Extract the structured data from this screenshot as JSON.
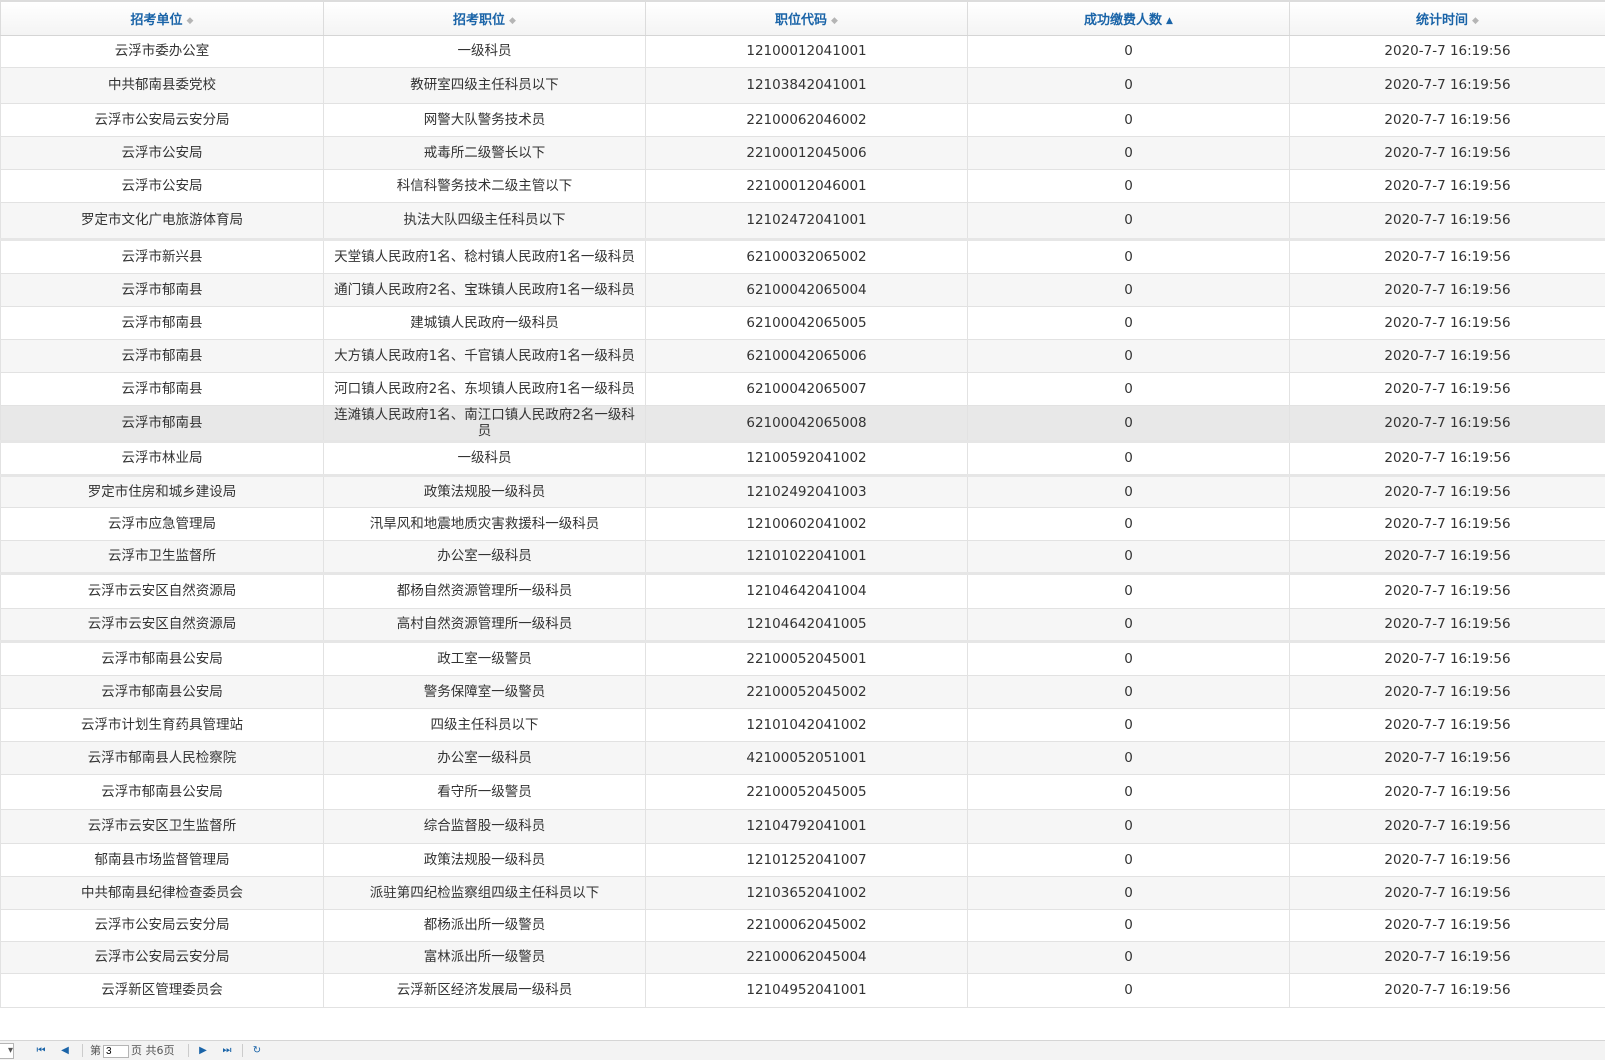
{
  "columns": [
    {
      "label": "招考单位",
      "sort": "none"
    },
    {
      "label": "招考职位",
      "sort": "none"
    },
    {
      "label": "职位代码",
      "sort": "none"
    },
    {
      "label": "成功缴费人数",
      "sort": "asc"
    },
    {
      "label": "统计时间",
      "sort": "none"
    }
  ],
  "rows": [
    [
      "云浮市委办公室",
      "一级科员",
      "12100012041001",
      "0",
      "2020-7-7 16:19:56"
    ],
    [
      "中共郁南县委党校",
      "教研室四级主任科员以下",
      "12103842041001",
      "0",
      "2020-7-7 16:19:56"
    ],
    [
      "云浮市公安局云安分局",
      "网警大队警务技术员",
      "22100062046002",
      "0",
      "2020-7-7 16:19:56"
    ],
    [
      "云浮市公安局",
      "戒毒所二级警长以下",
      "22100012045006",
      "0",
      "2020-7-7 16:19:56"
    ],
    [
      "云浮市公安局",
      "科信科警务技术二级主管以下",
      "22100012046001",
      "0",
      "2020-7-7 16:19:56"
    ],
    [
      "罗定市文化广电旅游体育局",
      "执法大队四级主任科员以下",
      "12102472041001",
      "0",
      "2020-7-7 16:19:56"
    ],
    [
      "云浮市新兴县",
      "天堂镇人民政府1名、稔村镇人民政府1名一级科员",
      "62100032065002",
      "0",
      "2020-7-7 16:19:56"
    ],
    [
      "云浮市郁南县",
      "通门镇人民政府2名、宝珠镇人民政府1名一级科员",
      "62100042065004",
      "0",
      "2020-7-7 16:19:56"
    ],
    [
      "云浮市郁南县",
      "建城镇人民政府一级科员",
      "62100042065005",
      "0",
      "2020-7-7 16:19:56"
    ],
    [
      "云浮市郁南县",
      "大方镇人民政府1名、千官镇人民政府1名一级科员",
      "62100042065006",
      "0",
      "2020-7-7 16:19:56"
    ],
    [
      "云浮市郁南县",
      "河口镇人民政府2名、东坝镇人民政府1名一级科员",
      "62100042065007",
      "0",
      "2020-7-7 16:19:56"
    ],
    [
      "云浮市郁南县",
      "连滩镇人民政府1名、南江口镇人民政府2名一级科员",
      "62100042065008",
      "0",
      "2020-7-7 16:19:56"
    ],
    [
      "云浮市林业局",
      "一级科员",
      "12100592041002",
      "0",
      "2020-7-7 16:19:56"
    ],
    [
      "罗定市住房和城乡建设局",
      "政策法规股一级科员",
      "12102492041003",
      "0",
      "2020-7-7 16:19:56"
    ],
    [
      "云浮市应急管理局",
      "汛旱风和地震地质灾害救援科一级科员",
      "12100602041002",
      "0",
      "2020-7-7 16:19:56"
    ],
    [
      "云浮市卫生监督所",
      "办公室一级科员",
      "12101022041001",
      "0",
      "2020-7-7 16:19:56"
    ],
    [
      "云浮市云安区自然资源局",
      "都杨自然资源管理所一级科员",
      "12104642041004",
      "0",
      "2020-7-7 16:19:56"
    ],
    [
      "云浮市云安区自然资源局",
      "高村自然资源管理所一级科员",
      "12104642041005",
      "0",
      "2020-7-7 16:19:56"
    ],
    [
      "云浮市郁南县公安局",
      "政工室一级警员",
      "22100052045001",
      "0",
      "2020-7-7 16:19:56"
    ],
    [
      "云浮市郁南县公安局",
      "警务保障室一级警员",
      "22100052045002",
      "0",
      "2020-7-7 16:19:56"
    ],
    [
      "云浮市计划生育药具管理站",
      "四级主任科员以下",
      "12101042041002",
      "0",
      "2020-7-7 16:19:56"
    ],
    [
      "云浮市郁南县人民检察院",
      "办公室一级科员",
      "42100052051001",
      "0",
      "2020-7-7 16:19:56"
    ],
    [
      "云浮市郁南县公安局",
      "看守所一级警员",
      "22100052045005",
      "0",
      "2020-7-7 16:19:56"
    ],
    [
      "云浮市云安区卫生监督所",
      "综合监督股一级科员",
      "12104792041001",
      "0",
      "2020-7-7 16:19:56"
    ],
    [
      "郁南县市场监督管理局",
      "政策法规股一级科员",
      "12101252041007",
      "0",
      "2020-7-7 16:19:56"
    ],
    [
      "中共郁南县纪律检查委员会",
      "派驻第四纪检监察组四级主任科员以下",
      "12103652041002",
      "0",
      "2020-7-7 16:19:56"
    ],
    [
      "云浮市公安局云安分局",
      "都杨派出所一级警员",
      "22100062045002",
      "0",
      "2020-7-7 16:19:56"
    ],
    [
      "云浮市公安局云安分局",
      "富林派出所一级警员",
      "22100062045004",
      "0",
      "2020-7-7 16:19:56"
    ],
    [
      "云浮新区管理委员会",
      "云浮新区经济发展局一级科员",
      "12104952041001",
      "0",
      "2020-7-7 16:19:56"
    ]
  ],
  "pager": {
    "first_icon": "first-page-icon",
    "prev_icon": "prev-page-icon",
    "next_icon": "next-page-icon",
    "last_icon": "last-page-icon",
    "refresh_icon": "refresh-icon",
    "page_prefix": "第",
    "page_value": "3",
    "page_suffix": "页 共6页"
  }
}
